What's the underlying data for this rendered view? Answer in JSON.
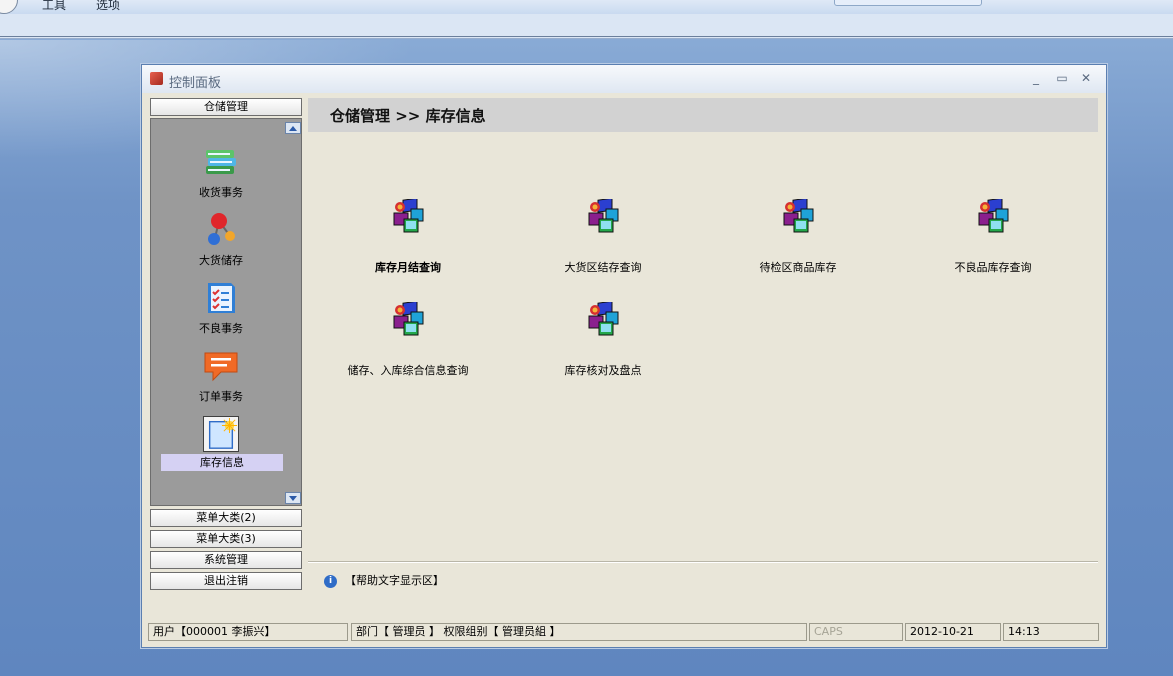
{
  "app_menu": [
    "工具",
    "选项"
  ],
  "window": {
    "title": "控制面板",
    "buttons": {
      "minimize": "_",
      "maximize": "▭",
      "close": "✕"
    }
  },
  "sidebar": {
    "active_category": "仓储管理",
    "items": [
      {
        "label": "收货事务",
        "icon": "book-stack-icon"
      },
      {
        "label": "大货储存",
        "icon": "molecule-icon"
      },
      {
        "label": "不良事务",
        "icon": "checklist-icon"
      },
      {
        "label": "订单事务",
        "icon": "speech-bubble-icon"
      },
      {
        "label": "库存信息",
        "icon": "new-document-icon",
        "selected": true
      }
    ],
    "categories": [
      "菜单大类(2)",
      "菜单大类(3)",
      "系统管理",
      "退出注销"
    ]
  },
  "content": {
    "breadcrumb": "仓储管理 >> 库存信息",
    "items": [
      {
        "label": "库存月结查询",
        "bold": true
      },
      {
        "label": "大货区结存查询"
      },
      {
        "label": "待检区商品库存"
      },
      {
        "label": "不良品库存查询"
      },
      {
        "label": "储存、入库综合信息查询"
      },
      {
        "label": "库存核对及盘点"
      }
    ],
    "help_text": "【帮助文字显示区】"
  },
  "statusbar": {
    "user": "用户【000001 李振兴】",
    "dept": "部门【 管理员 】 权限组别【 管理员組 】",
    "caps": "CAPS",
    "date": "2012-10-21",
    "time": "14:13"
  },
  "colors": {
    "desktop": "#6f93c6",
    "window_bg": "#e9e6d9",
    "sidebar_bg": "#9b9b9b",
    "selected_label": "#d5d1f3",
    "breadcrumb_bg": "#d2d2d2"
  }
}
